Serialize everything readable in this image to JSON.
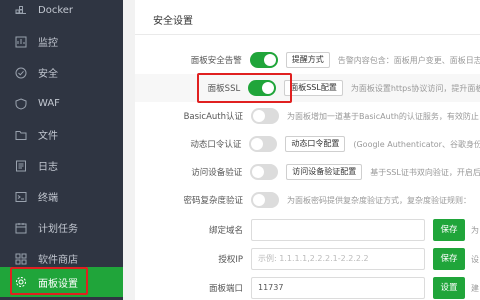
{
  "sidebar": {
    "items": [
      {
        "label": "Docker",
        "icon": "docker-icon"
      },
      {
        "label": "监控",
        "icon": "monitor-icon"
      },
      {
        "label": "安全",
        "icon": "shield-icon"
      },
      {
        "label": "WAF",
        "icon": "waf-icon"
      },
      {
        "label": "文件",
        "icon": "folder-icon"
      },
      {
        "label": "日志",
        "icon": "log-icon"
      },
      {
        "label": "终端",
        "icon": "terminal-icon"
      },
      {
        "label": "计划任务",
        "icon": "calendar-icon"
      },
      {
        "label": "软件商店",
        "icon": "store-icon"
      },
      {
        "label": "面板设置",
        "icon": "gear-icon",
        "active": true
      }
    ]
  },
  "panel": {
    "title": "安全设置",
    "rows": {
      "alarm": {
        "label": "面板安全告警",
        "button": "提醒方式",
        "desc": "告警内容包含：面板用户变更、面板日志"
      },
      "ssl": {
        "label": "面板SSL",
        "button": "面板SSL配置",
        "desc": "为面板设置https协议访问，提升面板"
      },
      "basicauth": {
        "label": "BasicAuth认证",
        "desc": "为面板增加一道基于BasicAuth的认证服务，有效防止"
      },
      "dynamic": {
        "label": "动态口令认证",
        "button": "动态口令配置",
        "desc": "(Google Authenticator、谷歌身份"
      },
      "device": {
        "label": "访问设备验证",
        "button": "访问设备验证配置",
        "desc": "基于SSL证书双向验证，开启后"
      },
      "password": {
        "label": "密码复杂度验证",
        "desc": "为面板密码提供复杂度验证方式，复杂度验证规则："
      },
      "domain": {
        "label": "绑定域名",
        "value": "",
        "save": "保存",
        "trail": "为"
      },
      "ip": {
        "label": "授权IP",
        "placeholder": "示例: 1.1.1.1,2.2.2.1-2.2.2.2",
        "save": "保存",
        "trail": "设"
      },
      "port": {
        "label": "面板端口",
        "value": "11737",
        "save": "设置",
        "trail": "建"
      }
    }
  },
  "colors": {
    "accent": "#20a53a",
    "sidebar_bg": "#2f3542",
    "highlight": "#e02020"
  }
}
